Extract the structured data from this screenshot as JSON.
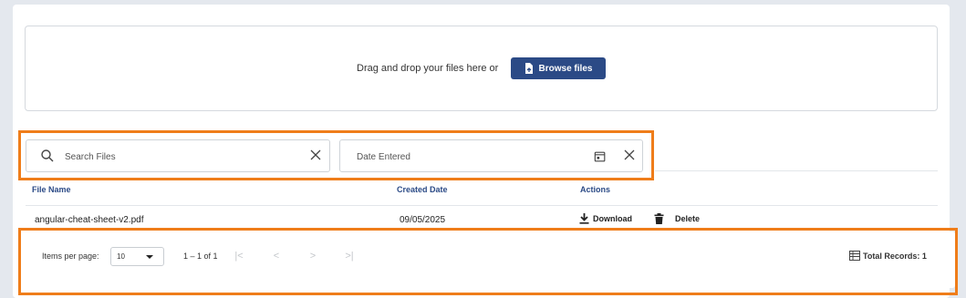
{
  "upload": {
    "drop_text": "Drag and drop your files here or",
    "browse_label": "Browse files"
  },
  "filters": {
    "search_placeholder": "Search Files",
    "date_placeholder": "Date Entered"
  },
  "table": {
    "headers": [
      "File Name",
      "Created Date",
      "Actions"
    ],
    "rows": [
      {
        "file_name": "angular-cheat-sheet-v2.pdf",
        "created_date": "09/05/2025",
        "download_label": "Download",
        "delete_label": "Delete"
      }
    ]
  },
  "paginator": {
    "items_per_page_label": "Items per page:",
    "page_size": "10",
    "range_label": "1 – 1 of 1",
    "total_label": "Total Records: 1"
  },
  "colors": {
    "accent": "#2b4a86",
    "highlight": "#ef7d1a"
  },
  "icons": [
    "file-upload-icon",
    "search-icon",
    "clear-icon",
    "calendar-icon",
    "download-icon",
    "trash-icon",
    "first-page-icon",
    "previous-page-icon",
    "next-page-icon",
    "last-page-icon",
    "table-icon"
  ]
}
